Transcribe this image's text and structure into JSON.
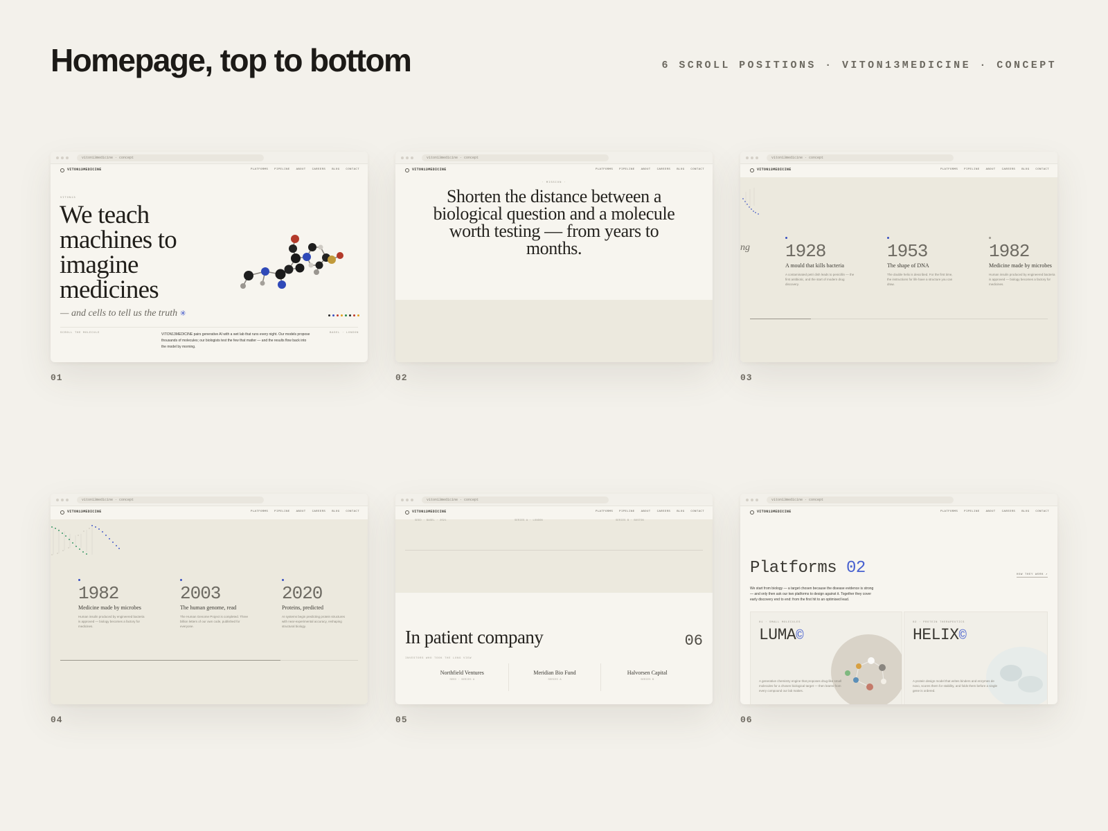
{
  "header": {
    "title": "Homepage, top to bottom",
    "meta": "6 SCROLL POSITIONS · VITON13MEDICINE · CONCEPT"
  },
  "browser": {
    "url": "viton13medicine · concept",
    "brand": "VITON13MEDICINE",
    "nav": [
      "PLATFORMS",
      "PIPELINE",
      "ABOUT",
      "CAREERS",
      "BLOG",
      "CONTACT"
    ]
  },
  "labels": [
    "01",
    "02",
    "03",
    "04",
    "05",
    "06"
  ],
  "card1": {
    "eyebrow": "VITON13",
    "headline": "We teach machines to imagine medicines",
    "subline": "— and cells to tell us the truth",
    "star": "✳",
    "foot_left": "SCROLL THE MOLECULE",
    "foot_body": "VITON13MEDICINE pairs generative AI with a wet lab that runs every night. Our models propose thousands of molecules; our biologists test the few that matter — and the results flow back into the model by morning.",
    "foot_right": "BASEL · LONDON",
    "dot_colors": [
      "#2a2a2a",
      "#3950c0",
      "#c0392b",
      "#e0a020",
      "#2a8a4a",
      "#2a2a2a",
      "#c0392b",
      "#e0a020"
    ]
  },
  "card2": {
    "eyebrow": "· MISSION ·",
    "quote": "Shorten the distance between a biological question and a molecule worth testing — from years to months."
  },
  "card3": {
    "ng": "ng",
    "items": [
      {
        "year": "1928",
        "title": "A mould that kills bacteria",
        "desc": "A contaminated petri dish leads to penicillin — the first antibiotic, and the start of modern drug discovery."
      },
      {
        "year": "1953",
        "title": "The shape of DNA",
        "desc": "The double helix is described. For the first time, the instructions for life have a structure you can draw."
      },
      {
        "year": "1982",
        "title": "Medicine made by microbes",
        "desc": "Human insulin produced by engineered bacteria is approved — biology becomes a factory for medicines."
      }
    ]
  },
  "card4": {
    "items": [
      {
        "year": "1982",
        "title": "Medicine made by microbes",
        "desc": "Human insulin produced by engineered bacteria is approved — biology becomes a factory for medicines."
      },
      {
        "year": "2003",
        "title": "The human genome, read",
        "desc": "The Human Genome Project is completed. Three billion letters of our own code, published for everyone."
      },
      {
        "year": "2020",
        "title": "Proteins, predicted",
        "desc": "AI systems begin predicting protein structures with near-experimental accuracy, reshaping structural biology."
      }
    ]
  },
  "card5": {
    "faint": [
      "SEED · BASEL · 2021",
      "SERIES A · LONDON",
      "SERIES B · BOSTON"
    ],
    "title": "In patient company",
    "count": "06",
    "eyebrow": "INVESTORS WHO TOOK THE LONG VIEW",
    "investors": [
      {
        "name": "Northfield Ventures",
        "sub": "SEED · SERIES A"
      },
      {
        "name": "Meridian Bio Fund",
        "sub": "SERIES A"
      },
      {
        "name": "Halvorsen Capital",
        "sub": "SERIES B"
      }
    ]
  },
  "card6": {
    "title": "Platforms",
    "title_num": "02",
    "how": "HOW THEY WORK ↗",
    "body": "We start from biology — a target chosen because the disease evidence is strong — and only then ask our two platforms to design against it. Together they cover early discovery end to end: from the first hit to an optimised lead.",
    "panels": [
      {
        "eyebrow": "01 · SMALL MOLECULES",
        "name": "LUMA",
        "mark": "©",
        "desc": "A generative chemistry engine that proposes drug-like small molecules for a chosen biological target — then learns from every compound our lab makes."
      },
      {
        "eyebrow": "02 · PROTEIN THERAPEUTICS",
        "name": "HELIX",
        "mark": "©",
        "desc": "A protein design model that writes binders and enzymes de novo, scores them for stability, and folds them before a single gene is ordered."
      }
    ]
  }
}
